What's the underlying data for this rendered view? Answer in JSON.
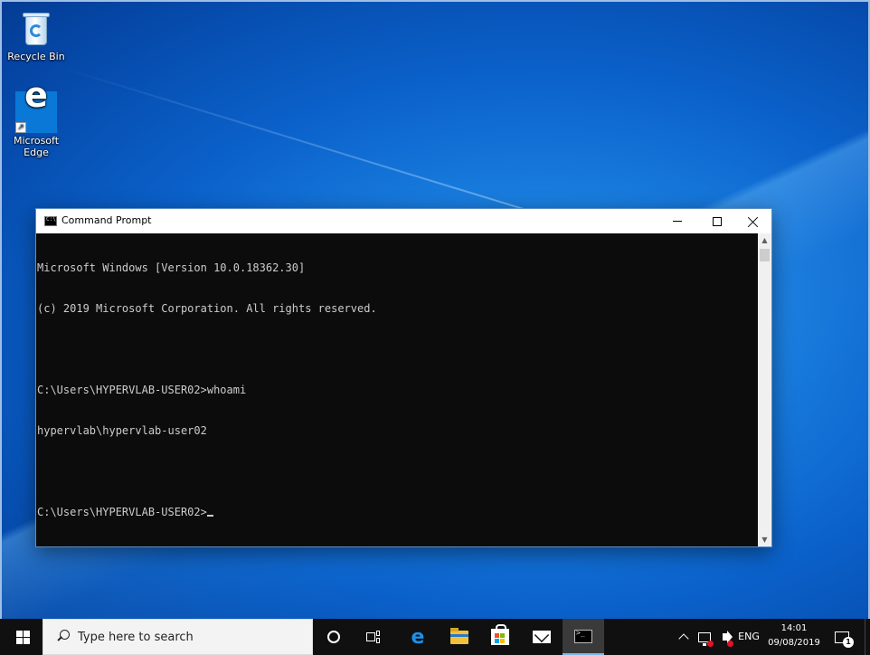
{
  "desktop": {
    "icons": [
      {
        "label": "Recycle Bin",
        "icon": "recycle-bin-icon"
      },
      {
        "label": "Microsoft Edge",
        "label_line1": "Microsoft",
        "label_line2": "Edge",
        "icon": "edge-icon"
      }
    ]
  },
  "window": {
    "title": "Command Prompt",
    "icon": "cmd-icon",
    "controls": {
      "minimize": "minimize-icon",
      "maximize": "maximize-icon",
      "close": "close-icon"
    },
    "console_lines": [
      "Microsoft Windows [Version 10.0.18362.30]",
      "(c) 2019 Microsoft Corporation. All rights reserved.",
      "",
      "C:\\Users\\HYPERVLAB-USER02>whoami",
      "hypervlab\\hypervlab-user02",
      "",
      "C:\\Users\\HYPERVLAB-USER02>"
    ],
    "console_colors": {
      "background": "#0c0c0c",
      "text": "#cccccc"
    }
  },
  "taskbar": {
    "search": {
      "placeholder": "Type here to search"
    },
    "pinned": [
      "cortana-icon",
      "task-view-icon",
      "edge-icon",
      "file-explorer-icon",
      "store-icon",
      "mail-icon",
      "cmd-icon"
    ],
    "active_app": "Command Prompt",
    "tray": {
      "language": "ENG",
      "time": "14:01",
      "date": "09/08/2019",
      "notification_count": "1"
    },
    "accent_color": "#76b9ed"
  }
}
